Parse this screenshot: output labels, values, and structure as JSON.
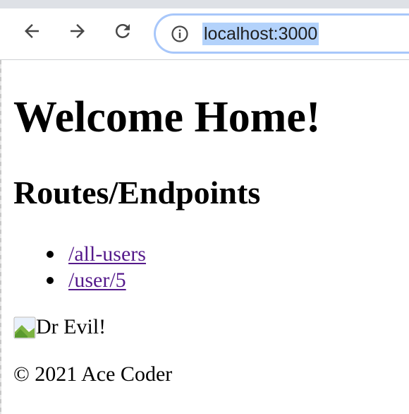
{
  "browser": {
    "url": "localhost:3000",
    "icons": {
      "back": "arrow-left-icon",
      "forward": "arrow-right-icon",
      "reload": "reload-icon",
      "site_info": "info-icon"
    },
    "url_highlight_color": "#b3d2fb",
    "omnibox_border_color": "#a8c7fa"
  },
  "page": {
    "heading": "Welcome Home!",
    "subheading": "Routes/Endpoints",
    "routes": [
      {
        "label": "/all-users"
      },
      {
        "label": "/user/5"
      }
    ],
    "image_alt": "Dr Evil!",
    "footer": "© 2021 Ace Coder",
    "link_color": "#551a8b"
  }
}
